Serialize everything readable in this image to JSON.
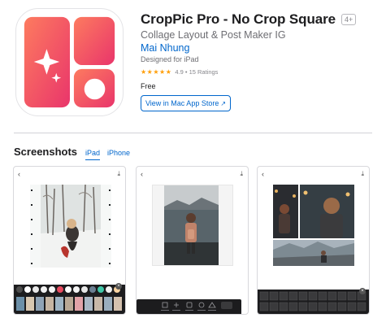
{
  "app": {
    "title": "CropPic Pro - No Crop Square",
    "age_rating": "4+",
    "subtitle": "Collage Layout & Post Maker IG",
    "developer": "Mai Nhung",
    "platform_note": "Designed for iPad",
    "stars": "★★★★★",
    "rating_text": "4.9 • 15 Ratings",
    "price": "Free",
    "view_button_label": "View in Mac App Store",
    "view_button_arrow": "↗"
  },
  "icon": {
    "name": "croppic-app-icon",
    "gradient": [
      "#fd7b5f",
      "#e9356b"
    ]
  },
  "screenshots": {
    "title": "Screenshots",
    "tabs": [
      {
        "label": "iPad",
        "selected": true
      },
      {
        "label": "iPhone",
        "selected": false
      }
    ],
    "back_glyph": "‹",
    "share_glyph": "⤓",
    "items": [
      {
        "name": "screenshot-winter-photo-editor"
      },
      {
        "name": "screenshot-lake-photo-editor"
      },
      {
        "name": "screenshot-collage-grid"
      }
    ]
  },
  "colors": {
    "accent": "#0066cc",
    "star": "#ff9f0a",
    "toolbar": "#1c1c1e"
  }
}
